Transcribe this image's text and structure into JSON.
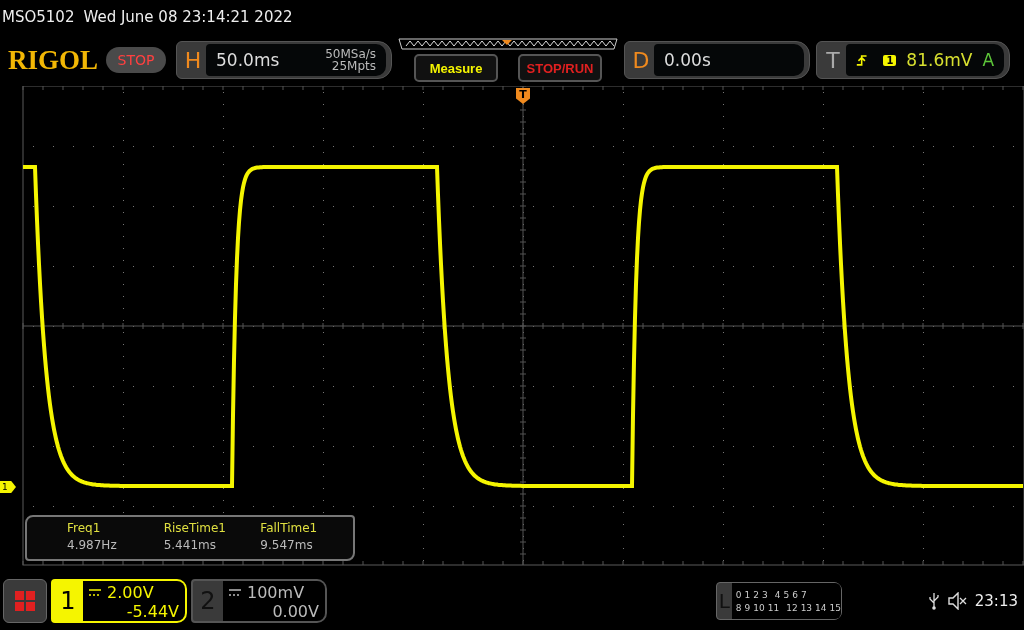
{
  "status_line": {
    "model": "MSO5102",
    "datetime": "Wed June 08 23:14:21 2022"
  },
  "header": {
    "logo": "RIGOL",
    "run_state": "STOP",
    "horizontal": {
      "label": "H",
      "timebase": "50.0ms",
      "sample_rate": "50MSa/s",
      "memory_depth": "25Mpts"
    },
    "buttons": [
      "Measure",
      "STOP/RUN"
    ],
    "delay": {
      "label": "D",
      "value": "0.00s"
    },
    "trigger": {
      "label": "T",
      "channel": "1",
      "level": "81.6mV",
      "sweep": "A"
    }
  },
  "trigger_marker": "T",
  "channel_marker": "1",
  "measurements": [
    {
      "name": "Freq1",
      "value": "4.987Hz"
    },
    {
      "name": "RiseTime1",
      "value": "5.441ms"
    },
    {
      "name": "FallTime1",
      "value": "9.547ms"
    }
  ],
  "channels": [
    {
      "number": "1",
      "selected": true,
      "scale": "2.00V",
      "offset": "-5.44V"
    },
    {
      "number": "2",
      "selected": false,
      "scale": "100mV",
      "offset": "0.00V"
    }
  ],
  "logic": {
    "label": "L",
    "row_1": [
      "0",
      "1",
      "2",
      "3",
      "4",
      "5",
      "6",
      "7"
    ],
    "row_2": [
      "8",
      "9",
      "10",
      "11",
      "12",
      "13",
      "14",
      "15"
    ]
  },
  "clock": "23:13"
}
